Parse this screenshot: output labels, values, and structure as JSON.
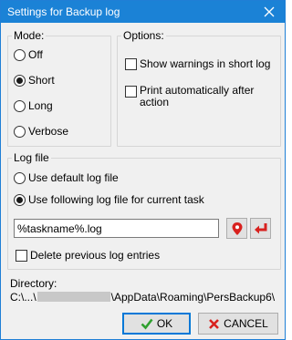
{
  "window": {
    "title": "Settings for Backup log"
  },
  "mode": {
    "label": "Mode:",
    "options": [
      "Off",
      "Short",
      "Long",
      "Verbose"
    ],
    "selected": "Short"
  },
  "options": {
    "label": "Options:",
    "items": [
      {
        "label": "Show warnings in short log",
        "checked": false
      },
      {
        "label": "Print automatically after action",
        "checked": false
      }
    ]
  },
  "logfile": {
    "label": "Log file",
    "options": [
      "Use default log file",
      "Use following log file for current task"
    ],
    "selected": "Use following log file for current task",
    "value": "%taskname%.log",
    "delete_previous": {
      "label": "Delete previous log entries",
      "checked": false
    }
  },
  "directory": {
    "label": "Directory:",
    "prefix": "C:\\...\\",
    "suffix": "\\AppData\\Roaming\\PersBackup6\\"
  },
  "buttons": {
    "ok": "OK",
    "cancel": "CANCEL"
  },
  "colors": {
    "title_bar": "#1b82d6",
    "ok_check": "#2fa02f",
    "cancel_x": "#d8211e",
    "icon_red": "#d8211e"
  }
}
